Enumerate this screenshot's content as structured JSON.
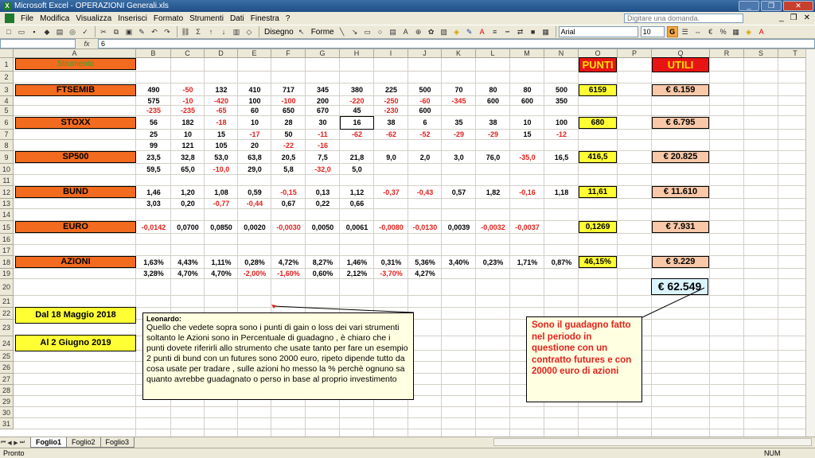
{
  "window": {
    "title": "Microsoft Excel - OPERAZIONI Generali.xls"
  },
  "menu": {
    "items": [
      "File",
      "Modifica",
      "Visualizza",
      "Inserisci",
      "Formato",
      "Strumenti",
      "Dati",
      "Finestra",
      "?"
    ],
    "ask_placeholder": "Digitare una domanda."
  },
  "toolbar": {
    "disegno": "Disegno",
    "forme": "Forme",
    "font": "Arial",
    "size": "10",
    "bold": "G"
  },
  "formula_bar": {
    "name_box": "",
    "fx": "fx",
    "value": "6"
  },
  "columns": [
    "A",
    "B",
    "C",
    "D",
    "E",
    "F",
    "G",
    "H",
    "I",
    "J",
    "K",
    "L",
    "M",
    "N",
    "O",
    "P",
    "Q",
    "R",
    "S",
    "T"
  ],
  "rows": [
    "1",
    "2",
    "3",
    "4",
    "5",
    "6",
    "7",
    "8",
    "9",
    "10",
    "11",
    "12",
    "13",
    "14",
    "15",
    "16",
    "17",
    "18",
    "19",
    "20",
    "21",
    "22",
    "23",
    "24",
    "25",
    "26",
    "27",
    "28",
    "29",
    "30",
    "31"
  ],
  "header_labels": {
    "punti": "PUNTI",
    "utili": "UTILI",
    "a1": "Strumento"
  },
  "instruments": [
    {
      "name": "FTSEMIB",
      "punti": "6159",
      "utili": "€ 6.159"
    },
    {
      "name": "STOXX",
      "punti": "680",
      "utili": "€ 6.795"
    },
    {
      "name": "SP500",
      "punti": "416,5",
      "utili": "€ 20.825"
    },
    {
      "name": "BUND",
      "punti": "11,61",
      "utili": "€ 11.610"
    },
    {
      "name": "EURO",
      "punti": "0,1269",
      "utili": "€ 7.931"
    },
    {
      "name": "AZIONI",
      "punti": "46,15%",
      "utili": "€ 9.229"
    }
  ],
  "data_rows": [
    {
      "row": 3,
      "values": [
        "490",
        "-50",
        "132",
        "410",
        "717",
        "345",
        "380",
        "225",
        "500",
        "70",
        "80",
        "80",
        "500"
      ]
    },
    {
      "row": 4,
      "values": [
        "575",
        "-10",
        "-420",
        "100",
        "-100",
        "200",
        "-220",
        "-250",
        "-60",
        "-345",
        "600",
        "600",
        "350"
      ]
    },
    {
      "row": 5,
      "values": [
        "-235",
        "-235",
        "-65",
        "60",
        "650",
        "670",
        "45",
        "-230",
        "600",
        "",
        "",
        "",
        ""
      ]
    },
    {
      "row": 6,
      "values": [
        "56",
        "182",
        "-18",
        "10",
        "28",
        "30",
        "16",
        "38",
        "6",
        "35",
        "38",
        "10",
        "100"
      ]
    },
    {
      "row": 7,
      "values": [
        "25",
        "10",
        "15",
        "-17",
        "50",
        "-11",
        "-62",
        "-62",
        "-52",
        "-29",
        "-29",
        "15",
        "-12"
      ]
    },
    {
      "row": 8,
      "values": [
        "99",
        "121",
        "105",
        "20",
        "-22",
        "-16",
        "",
        "",
        "",
        "",
        "",
        "",
        ""
      ]
    },
    {
      "row": 9,
      "values": [
        "23,5",
        "32,8",
        "53,0",
        "63,8",
        "20,5",
        "7,5",
        "21,8",
        "9,0",
        "2,0",
        "3,0",
        "76,0",
        "-35,0",
        "16,5"
      ]
    },
    {
      "row": 10,
      "values": [
        "59,5",
        "65,0",
        "-10,0",
        "29,0",
        "5,8",
        "-32,0",
        "5,0",
        "",
        "",
        "",
        "",
        "",
        ""
      ]
    },
    {
      "row": 12,
      "values": [
        "1,46",
        "1,20",
        "1,08",
        "0,59",
        "-0,15",
        "0,13",
        "1,12",
        "-0,37",
        "-0,43",
        "0,57",
        "1,82",
        "-0,16",
        "1,18"
      ]
    },
    {
      "row": 13,
      "values": [
        "3,03",
        "0,20",
        "-0,77",
        "-0,44",
        "0,67",
        "0,22",
        "0,66",
        "",
        "",
        "",
        "",
        "",
        ""
      ]
    },
    {
      "row": 15,
      "values": [
        "-0,0142",
        "0,0700",
        "0,0850",
        "0,0020",
        "-0,0030",
        "0,0050",
        "0,0061",
        "-0,0080",
        "-0,0130",
        "0,0039",
        "-0,0032",
        "-0,0037",
        ""
      ]
    },
    {
      "row": 18,
      "values": [
        "1,63%",
        "4,43%",
        "1,11%",
        "0,28%",
        "4,72%",
        "8,27%",
        "1,46%",
        "0,31%",
        "5,36%",
        "3,40%",
        "0,23%",
        "1,71%",
        "0,87%"
      ]
    },
    {
      "row": 19,
      "values": [
        "3,28%",
        "4,70%",
        "4,70%",
        "-2,00%",
        "-1,60%",
        "0,60%",
        "2,12%",
        "-3,70%",
        "4,27%",
        "",
        "",
        "",
        ""
      ]
    }
  ],
  "total": "€ 62.549",
  "dates": {
    "from": "Dal 18 Maggio  2018",
    "to": "Al 2 Giugno 2019"
  },
  "comment": {
    "author": "Leonardo:",
    "text": "Quello che vedete sopra sono i punti di gain o loss dei vari strumenti soltanto le Azioni sono in Percentuale di guadagno , è chiaro che i punti dovete riferirli allo strumento che usate tanto per fare un esempio 2 punti di bund con un futures sono 2000 euro, ripeto dipende tutto da cosa usate per tradare , sulle azioni ho messo la % perchè ognuno sa quanto avrebbe guadagnato o perso in base al proprio investimento"
  },
  "note": "Sono il guadagno fatto nel periodo in questione con un contratto futures e con 20000 euro di azioni",
  "sheets": [
    "Foglio1",
    "Foglio2",
    "Foglio3"
  ],
  "status": {
    "left": "Pronto",
    "right": "NUM"
  },
  "colors": {
    "orange": "#f26b1e",
    "yellow": "#ffff33",
    "red": "#e81414",
    "peach": "#f8c8a8",
    "note_bg": "#ffffe1"
  }
}
